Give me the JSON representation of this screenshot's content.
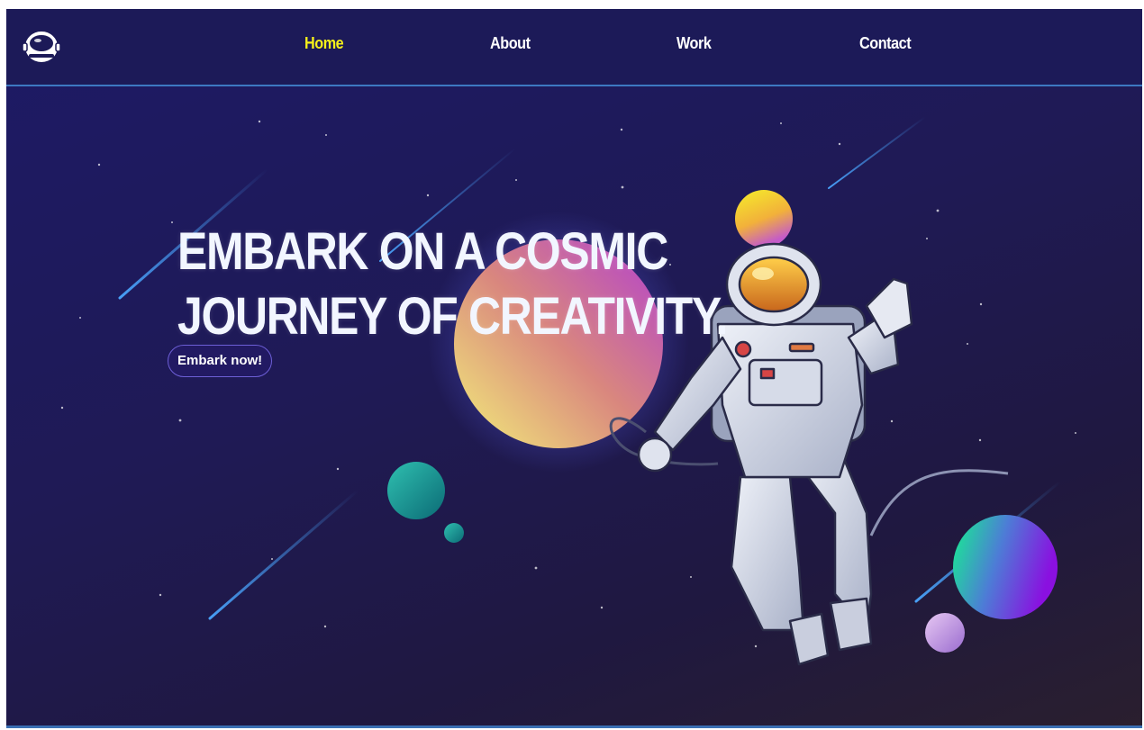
{
  "nav": {
    "links": [
      {
        "label": "Home",
        "active": true
      },
      {
        "label": "About",
        "active": false
      },
      {
        "label": "Work",
        "active": false
      },
      {
        "label": "Contact",
        "active": false
      }
    ],
    "logo_icon": "astronaut-helmet-icon"
  },
  "hero": {
    "title_line1": "EMBARK ON A COSMIC",
    "title_line2": "JOURNEY OF CREATIVITY.",
    "cta_label": "Embark now!"
  },
  "colors": {
    "background": "#1d1a66",
    "nav_background": "#1c1a58",
    "active_link": "#f5f01a",
    "accent_line": "#3d78c2"
  }
}
